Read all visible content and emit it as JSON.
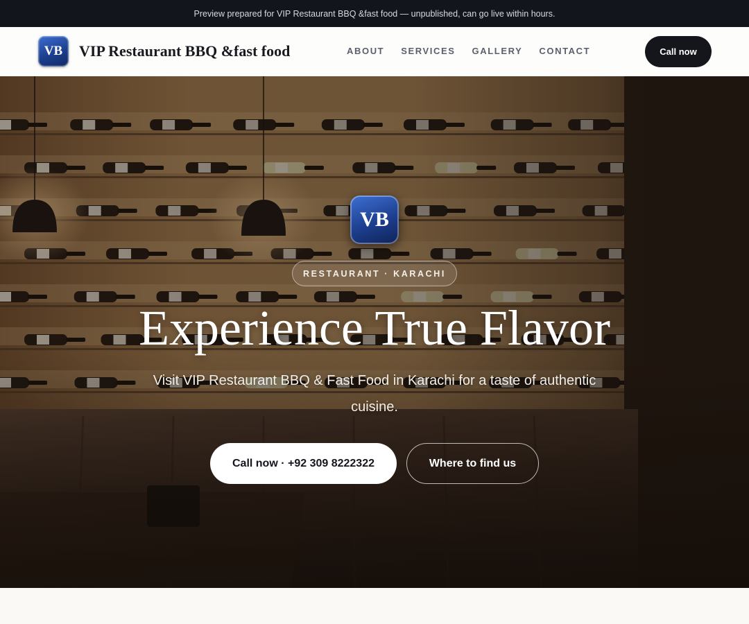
{
  "preview_bar": {
    "text": "Preview prepared for VIP Restaurant BBQ &fast food — unpublished, can go live within hours."
  },
  "header": {
    "logo_initials": "VB",
    "brand_name": "VIP Restaurant BBQ &fast food",
    "nav": [
      {
        "label": "ABOUT"
      },
      {
        "label": "SERVICES"
      },
      {
        "label": "GALLERY"
      },
      {
        "label": "CONTACT"
      }
    ],
    "cta_label": "Call now"
  },
  "hero": {
    "badge_initials": "VB",
    "tag": "RESTAURANT · KARACHI",
    "title": "Experience True Flavor",
    "subtitle": "Visit VIP Restaurant BBQ & Fast Food in Karachi for a taste of authentic cuisine.",
    "primary_button": "Call now · +92 309 8222322",
    "secondary_button": "Where to find us",
    "background_image": "restaurant-interior-wine-wall-photo"
  },
  "colors": {
    "topbar": "#13151c",
    "brand_blue": "#1d3f8e",
    "dark_button": "#14161c",
    "page_background": "#faf9f6"
  }
}
